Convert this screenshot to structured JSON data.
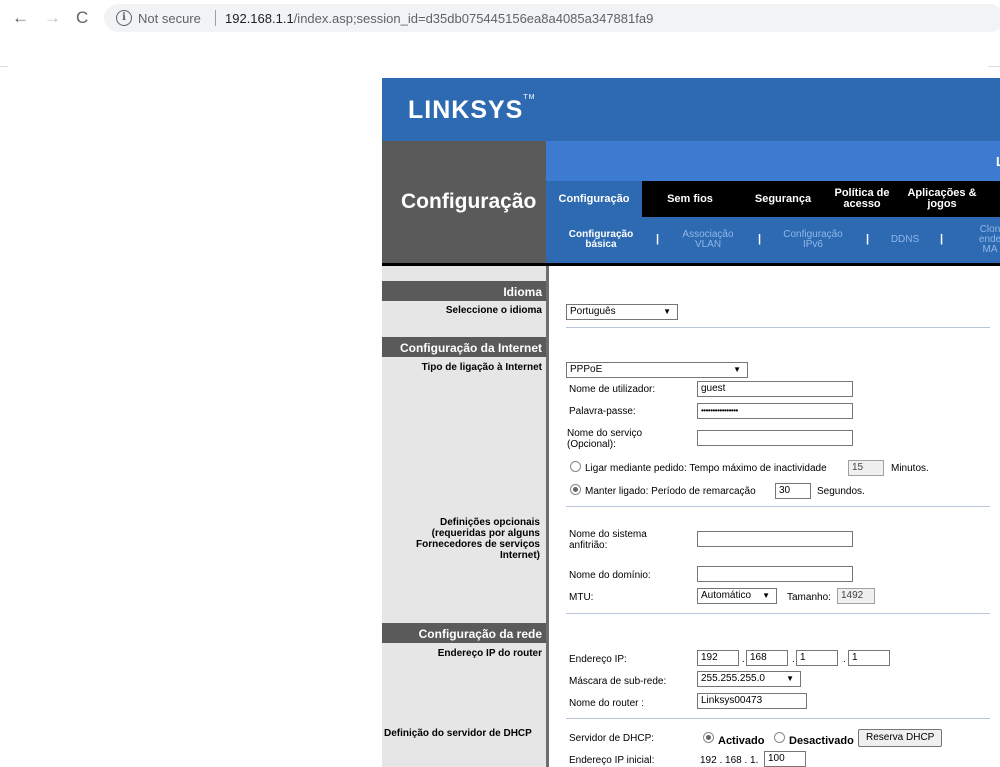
{
  "browser": {
    "not_secure": "Not secure",
    "url_host": "192.168.1.1",
    "url_path": "/index.asp;session_id=d35db075445156ea8a4085a347881fa9"
  },
  "brand": {
    "logo": "LINKSYS",
    "tm": "TM"
  },
  "page": {
    "title": "Configuração",
    "strip_letter": "L"
  },
  "tabs": [
    {
      "label": "Configuração",
      "active": true
    },
    {
      "label": "Sem fios",
      "active": false
    },
    {
      "label": "Segurança",
      "active": false
    },
    {
      "label": "Política de acesso",
      "active": false
    },
    {
      "label": "Aplicações & jogos",
      "active": false
    }
  ],
  "subtabs": [
    {
      "label": "Configuração básica",
      "active": true
    },
    {
      "label": "Associação VLAN",
      "active": false
    },
    {
      "label": "Configuração IPv6",
      "active": false
    },
    {
      "label": "DDNS",
      "active": false
    },
    {
      "label": "Clon ende MA",
      "active": false
    }
  ],
  "sections": {
    "idioma": "Idioma",
    "internet": "Configuração da Internet",
    "rede": "Configuração da rede"
  },
  "labels": {
    "select_lang": "Seleccione o idioma",
    "conn_type": "Tipo de ligação à Internet",
    "optional_defs": "Definições opcionais (requeridas por alguns Fornecedores de serviços Internet)",
    "router_ip": "Endereço IP do router",
    "dhcp_def": "Definição do servidor de DHCP"
  },
  "form": {
    "language": "Português",
    "conn_type": "PPPoE",
    "username_label": "Nome de utilizador:",
    "username": "guest",
    "password_label": "Palavra-passe:",
    "password": "••••••••••••••••",
    "service_label": "Nome do serviço (Opcional):",
    "service": "",
    "on_demand_label": "Ligar mediante pedido: Tempo máximo de inactividade",
    "idle_time": "15",
    "minutes": "Minutos.",
    "keep_alive_label": "Manter ligado: Período de remarcação",
    "redial": "30",
    "seconds": "Segundos.",
    "host_label": "Nome do sistema anfitrião:",
    "host": "",
    "domain_label": "Nome do domínio:",
    "domain": "",
    "mtu_label": "MTU:",
    "mtu_mode": "Automático",
    "size_label": "Tamanho:",
    "mtu_size": "1492",
    "ip_label": "Endereço IP:",
    "ip": [
      "192",
      "168",
      "1",
      "1"
    ],
    "mask_label": "Máscara de sub-rede:",
    "mask": "255.255.255.0",
    "router_name_label": "Nome do router :",
    "router_name": "Linksys00473",
    "dhcp_label": "Servidor de DHCP:",
    "dhcp_on": "Activado",
    "dhcp_off": "Desactivado",
    "dhcp_reserve": "Reserva DHCP",
    "start_ip_label": "Endereço IP inicial:",
    "start_ip_prefix": "192 . 168 . 1.",
    "start_ip_last": "100"
  },
  "dots": [
    ".",
    ".",
    "."
  ]
}
